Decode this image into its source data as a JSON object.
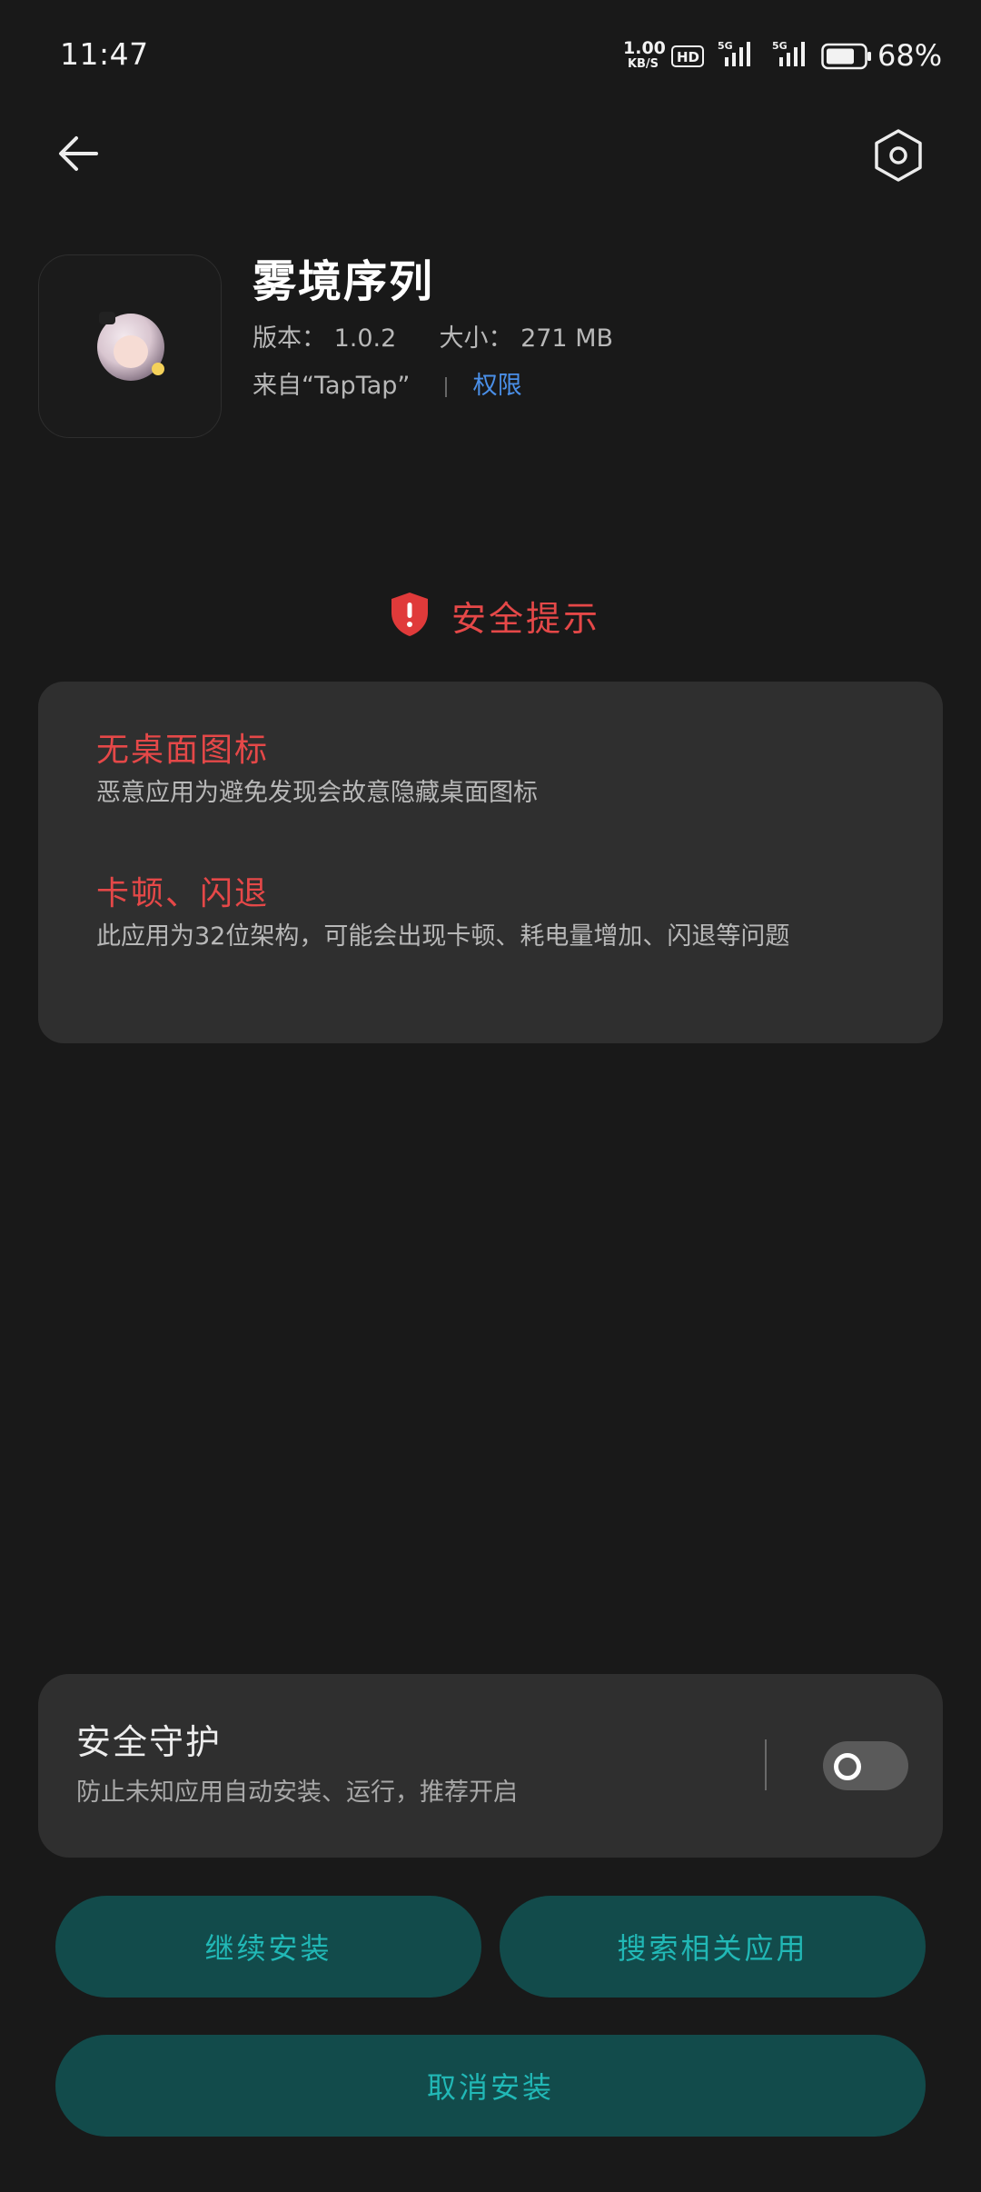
{
  "status_bar": {
    "time": "11:47",
    "net_speed_value": "1.00",
    "net_speed_unit": "KB/S",
    "hd_label": "HD",
    "sim1_label": "5G",
    "sim2_label": "5G",
    "battery_percent": "68%"
  },
  "nav": {
    "back_icon": "arrow-left-icon",
    "settings_icon": "hexagon-gear-icon"
  },
  "app": {
    "name": "雾境序列",
    "version_label": "版本：",
    "version": "1.0.2",
    "size_label": "大小：",
    "size": "271 MB",
    "source": "来自“TapTap”",
    "permissions_link": "权限"
  },
  "security_tip": {
    "title": "安全提示",
    "icon": "shield-exclamation-icon",
    "color": "#e54848",
    "items": [
      {
        "title": "无桌面图标",
        "description": "恶意应用为避免发现会故意隐藏桌面图标"
      },
      {
        "title": "卡顿、闪退",
        "description": "此应用为32位架构，可能会出现卡顿、耗电量增加、闪退等问题"
      }
    ]
  },
  "guard": {
    "title": "安全守护",
    "description": "防止未知应用自动安装、运行，推荐开启",
    "enabled": false
  },
  "buttons": {
    "continue": "继续安装",
    "search": "搜索相关应用",
    "cancel": "取消安装",
    "bg_color": "#124b4b",
    "text_color": "#21b8b6"
  }
}
